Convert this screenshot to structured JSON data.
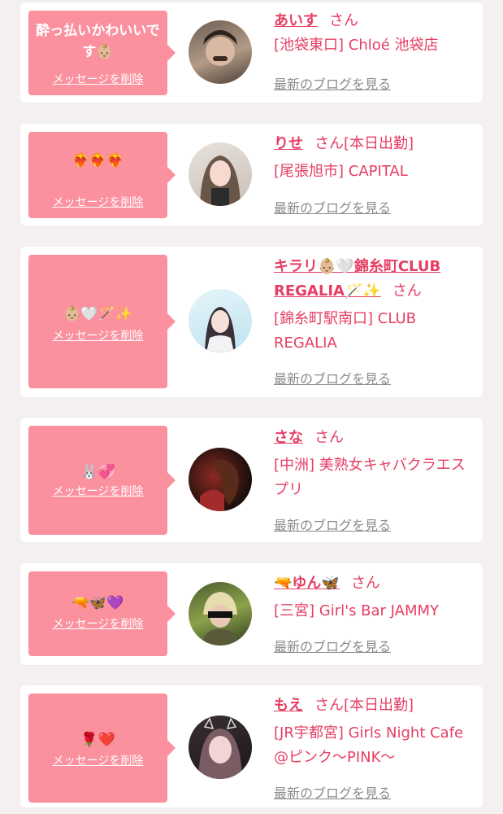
{
  "colors": {
    "accent": "#e63e63",
    "bubble": "#fb909e",
    "card": "#ffffff",
    "background": "#f4f0f1",
    "muted": "#8a8a8a"
  },
  "items": [
    {
      "message": "酔っ払いかわいいです👶🏼",
      "delete_label": "メッセージを削除",
      "name": "あいす",
      "honorific": "さん",
      "status": "",
      "shop": "[池袋東口] Chloé 池袋店",
      "blog_link": "最新のブログを見る"
    },
    {
      "message": "❤️‍🔥❤️‍🔥❤️‍🔥",
      "delete_label": "メッセージを削除",
      "name": "りせ",
      "honorific": "さん",
      "status": "[本日出勤]",
      "shop": "[尾張旭市] CAPITAL",
      "blog_link": "最新のブログを見る"
    },
    {
      "message": "👶🏼🤍🪄✨",
      "delete_label": "メッセージを削除",
      "name": "キラリ👶🏼🤍錦糸町CLUB REGALIA🪄✨",
      "honorific": "さん",
      "status": "",
      "shop": "[錦糸町駅南口] CLUB REGALIA",
      "blog_link": "最新のブログを見る"
    },
    {
      "message": "🐰💞",
      "delete_label": "メッセージを削除",
      "name": "さな",
      "honorific": "さん",
      "status": "",
      "shop": "[中洲] 美熟女キャバクラエスプリ",
      "blog_link": "最新のブログを見る"
    },
    {
      "message": "🔫🦋💜",
      "delete_label": "メッセージを削除",
      "name": "🔫ゆん🦋",
      "honorific": "さん",
      "status": "",
      "shop": "[三宮] Girl's Bar JAMMY",
      "blog_link": "最新のブログを見る"
    },
    {
      "message": "🌹❤️",
      "delete_label": "メッセージを削除",
      "name": "もえ",
      "honorific": "さん",
      "status": "[本日出勤]",
      "shop": "[JR宇都宮] Girls Night Cafe @ピンク〜PINK〜",
      "blog_link": "最新のブログを見る"
    }
  ]
}
